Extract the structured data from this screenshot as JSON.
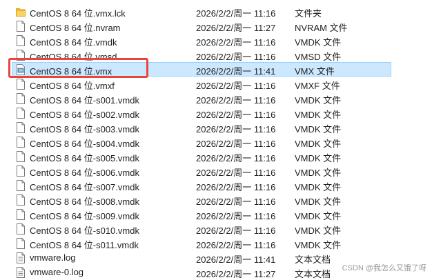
{
  "files": [
    {
      "name": "CentOS 8 64 位.vmx.lck",
      "date": "2026/2/2/周一 11:16",
      "type": "文件夹",
      "icon": "folder-icon"
    },
    {
      "name": "CentOS 8 64 位.nvram",
      "date": "2026/2/2/周一 11:27",
      "type": "NVRAM 文件",
      "icon": "file-icon"
    },
    {
      "name": "CentOS 8 64 位.vmdk",
      "date": "2026/2/2/周一 11:16",
      "type": "VMDK 文件",
      "icon": "file-icon"
    },
    {
      "name": "CentOS 8 64 位.vmsd",
      "date": "2026/2/2/周一 11:16",
      "type": "VMSD 文件",
      "icon": "file-icon"
    },
    {
      "name": "CentOS 8 64 位.vmx",
      "date": "2026/2/2/周一 11:41",
      "type": "VMX 文件",
      "icon": "vmx-file-icon",
      "selected": true
    },
    {
      "name": "CentOS 8 64 位.vmxf",
      "date": "2026/2/2/周一 11:16",
      "type": "VMXF 文件",
      "icon": "file-icon"
    },
    {
      "name": "CentOS 8 64 位-s001.vmdk",
      "date": "2026/2/2/周一 11:16",
      "type": "VMDK 文件",
      "icon": "file-icon"
    },
    {
      "name": "CentOS 8 64 位-s002.vmdk",
      "date": "2026/2/2/周一 11:16",
      "type": "VMDK 文件",
      "icon": "file-icon"
    },
    {
      "name": "CentOS 8 64 位-s003.vmdk",
      "date": "2026/2/2/周一 11:16",
      "type": "VMDK 文件",
      "icon": "file-icon"
    },
    {
      "name": "CentOS 8 64 位-s004.vmdk",
      "date": "2026/2/2/周一 11:16",
      "type": "VMDK 文件",
      "icon": "file-icon"
    },
    {
      "name": "CentOS 8 64 位-s005.vmdk",
      "date": "2026/2/2/周一 11:16",
      "type": "VMDK 文件",
      "icon": "file-icon"
    },
    {
      "name": "CentOS 8 64 位-s006.vmdk",
      "date": "2026/2/2/周一 11:16",
      "type": "VMDK 文件",
      "icon": "file-icon"
    },
    {
      "name": "CentOS 8 64 位-s007.vmdk",
      "date": "2026/2/2/周一 11:16",
      "type": "VMDK 文件",
      "icon": "file-icon"
    },
    {
      "name": "CentOS 8 64 位-s008.vmdk",
      "date": "2026/2/2/周一 11:16",
      "type": "VMDK 文件",
      "icon": "file-icon"
    },
    {
      "name": "CentOS 8 64 位-s009.vmdk",
      "date": "2026/2/2/周一 11:16",
      "type": "VMDK 文件",
      "icon": "file-icon"
    },
    {
      "name": "CentOS 8 64 位-s010.vmdk",
      "date": "2026/2/2/周一 11:16",
      "type": "VMDK 文件",
      "icon": "file-icon"
    },
    {
      "name": "CentOS 8 64 位-s011.vmdk",
      "date": "2026/2/2/周一 11:16",
      "type": "VMDK 文件",
      "icon": "file-icon"
    },
    {
      "name": "vmware.log",
      "date": "2026/2/2/周一 11:41",
      "type": "文本文档",
      "icon": "text-file-icon"
    },
    {
      "name": "vmware-0.log",
      "date": "2026/2/2/周一 11:27",
      "type": "文本文档",
      "icon": "text-file-icon"
    }
  ],
  "watermark": "CSDN @我怎么又饿了呀",
  "colors": {
    "selection_bg": "#cce8ff",
    "selection_border": "#99d1ff",
    "highlight": "#e8453c",
    "folder": "#f5c342"
  }
}
